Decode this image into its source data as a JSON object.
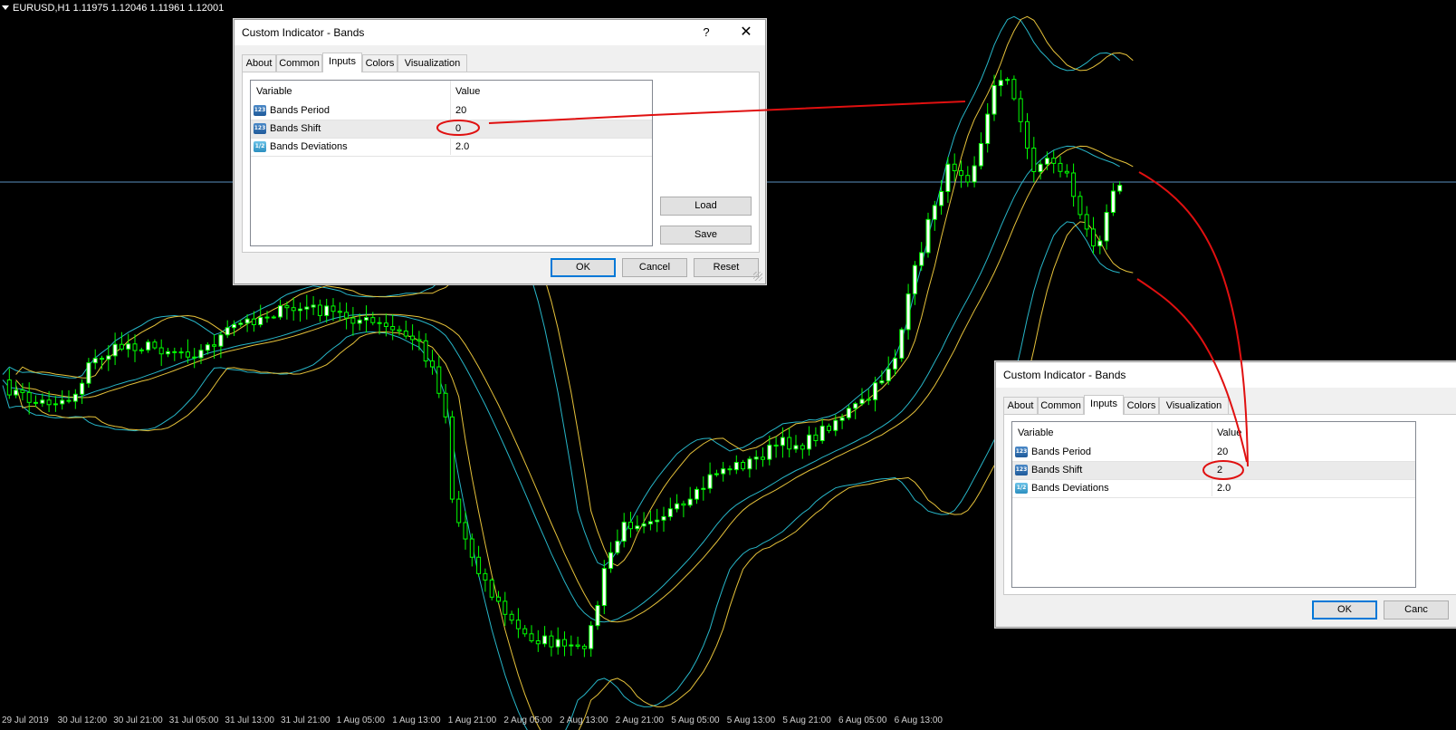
{
  "chart": {
    "symbol_label": "EURUSD,H1  1.11975 1.12046 1.11961 1.12001",
    "colors": {
      "background": "#000000",
      "candle": "#00ff00",
      "body": "#ffffff",
      "band_a": "#27b6c8",
      "band_b": "#e6c23a",
      "hline": "#5a8fc0",
      "annotation": "#e01010"
    },
    "time_labels": [
      "29 Jul 2019",
      "30 Jul 12:00",
      "30 Jul 21:00",
      "31 Jul 05:00",
      "31 Jul 13:00",
      "31 Jul 21:00",
      "1 Aug 05:00",
      "1 Aug 13:00",
      "1 Aug 21:00",
      "2 Aug 05:00",
      "2 Aug 13:00",
      "2 Aug 21:00",
      "5 Aug 05:00",
      "5 Aug 13:00",
      "5 Aug 21:00",
      "6 Aug 05:00",
      "6 Aug 13:00"
    ]
  },
  "dialog1": {
    "title": "Custom Indicator - Bands",
    "help": "?",
    "close": "✕",
    "tabs": [
      "About",
      "Common",
      "Inputs",
      "Colors",
      "Visualization"
    ],
    "active_tab": "Inputs",
    "headers": {
      "variable": "Variable",
      "value": "Value"
    },
    "rows": [
      {
        "name": "Bands Period",
        "value": "20",
        "icon": "integer-icon"
      },
      {
        "name": "Bands Shift",
        "value": "0",
        "icon": "integer-icon"
      },
      {
        "name": "Bands Deviations",
        "value": "2.0",
        "icon": "double-icon"
      }
    ],
    "load": "Load",
    "save": "Save",
    "ok": "OK",
    "cancel": "Cancel",
    "reset": "Reset"
  },
  "dialog2": {
    "title": "Custom Indicator - Bands",
    "tabs": [
      "About",
      "Common",
      "Inputs",
      "Colors",
      "Visualization"
    ],
    "active_tab": "Inputs",
    "headers": {
      "variable": "Variable",
      "value": "Value"
    },
    "rows": [
      {
        "name": "Bands Period",
        "value": "20",
        "icon": "integer-icon"
      },
      {
        "name": "Bands Shift",
        "value": "2",
        "icon": "integer-icon"
      },
      {
        "name": "Bands Deviations",
        "value": "2.0",
        "icon": "double-icon"
      }
    ],
    "ok": "OK",
    "cancel": "Canc"
  }
}
